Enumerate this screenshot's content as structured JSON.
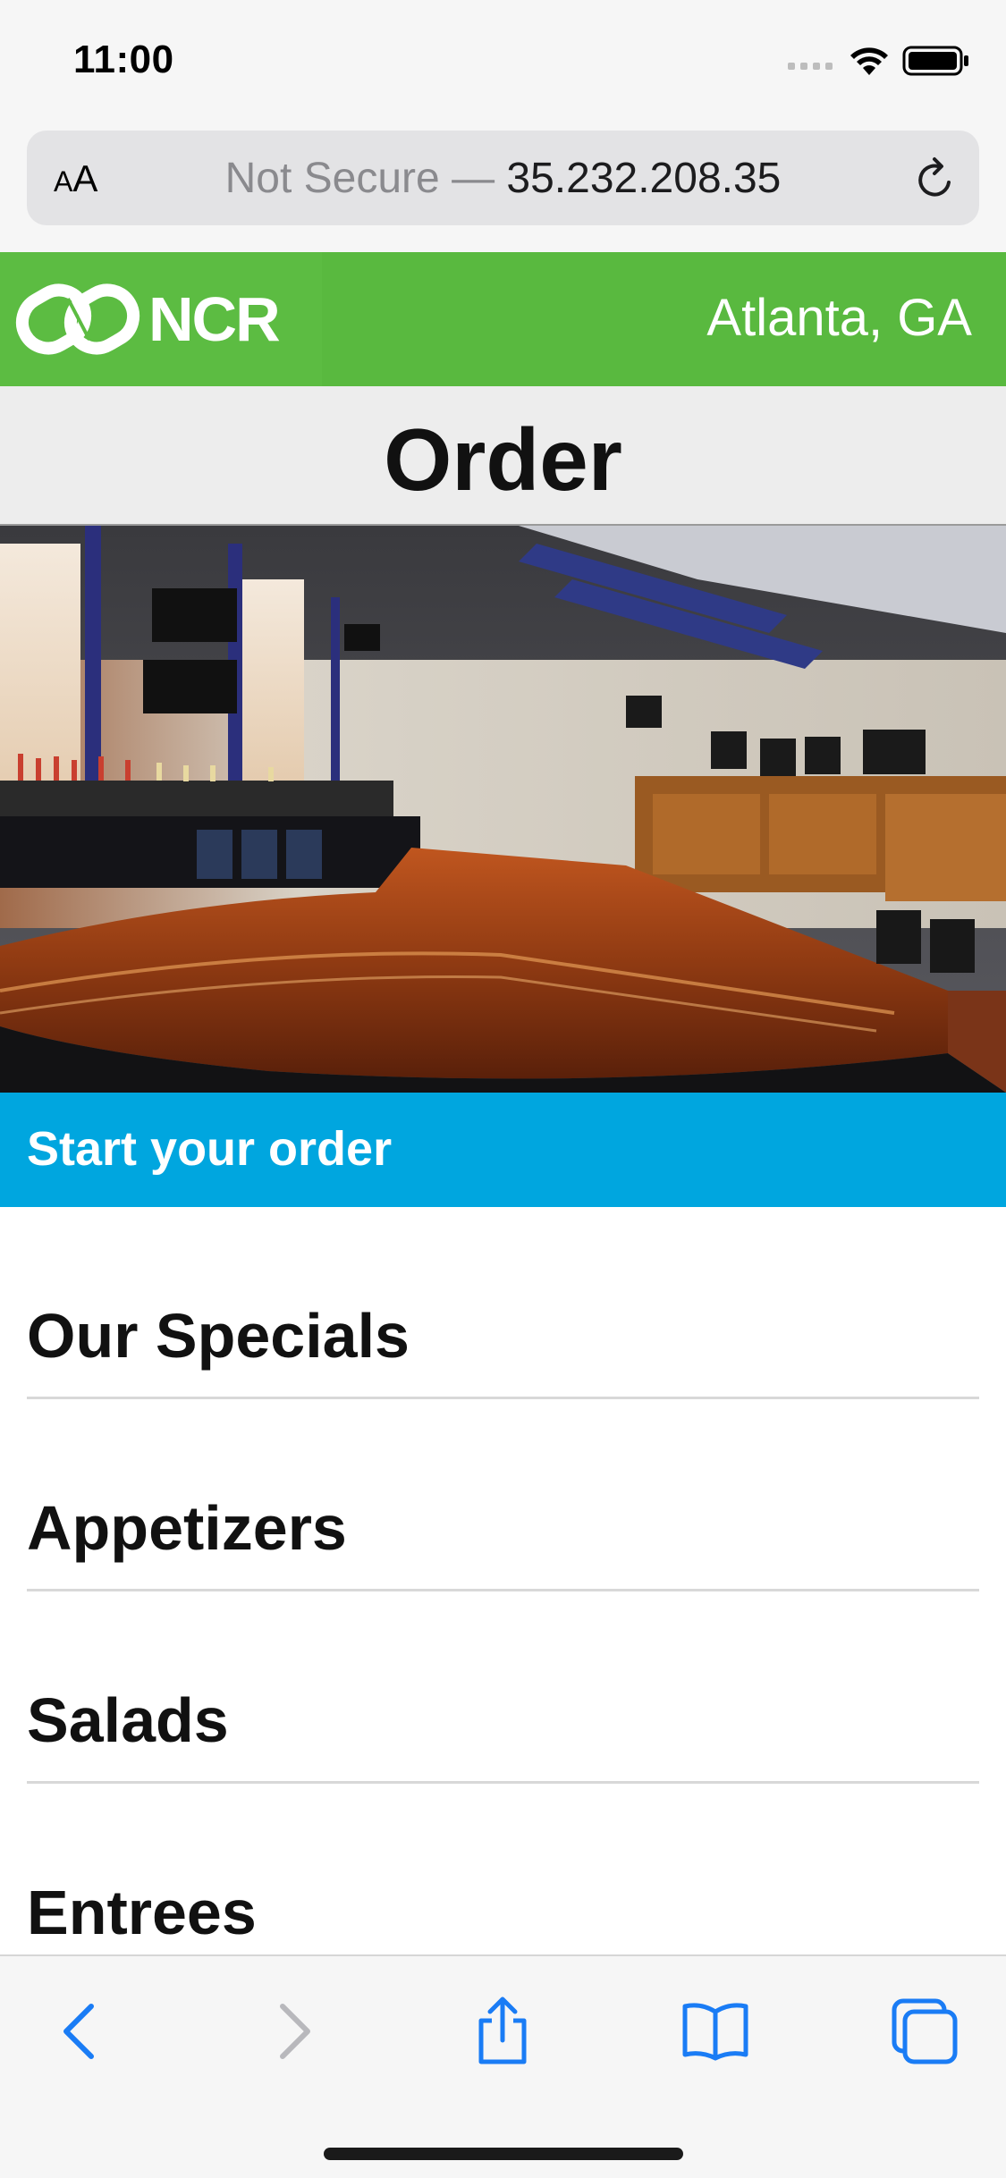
{
  "status_bar": {
    "time": "11:00"
  },
  "address_bar": {
    "aa_label_small": "A",
    "aa_label_large": "A",
    "insecure_label": "Not Secure — ",
    "host": "35.232.208.35",
    "reload_icon": "reload-icon"
  },
  "header": {
    "logo_text": "NCR",
    "location": "Atlanta, GA",
    "brand_color": "#59b93f"
  },
  "page": {
    "title": "Order"
  },
  "hero": {
    "alt": "restaurant bar interior"
  },
  "start": {
    "label": "Start your order",
    "color": "#00a6df"
  },
  "menu": {
    "items": [
      {
        "label": "Our Specials"
      },
      {
        "label": "Appetizers"
      },
      {
        "label": "Salads"
      },
      {
        "label": "Entrees"
      }
    ]
  },
  "toolbar": {
    "icons": [
      "back-icon",
      "forward-icon",
      "share-icon",
      "bookmarks-icon",
      "tabs-icon"
    ],
    "accent": "#1a7cf5"
  }
}
